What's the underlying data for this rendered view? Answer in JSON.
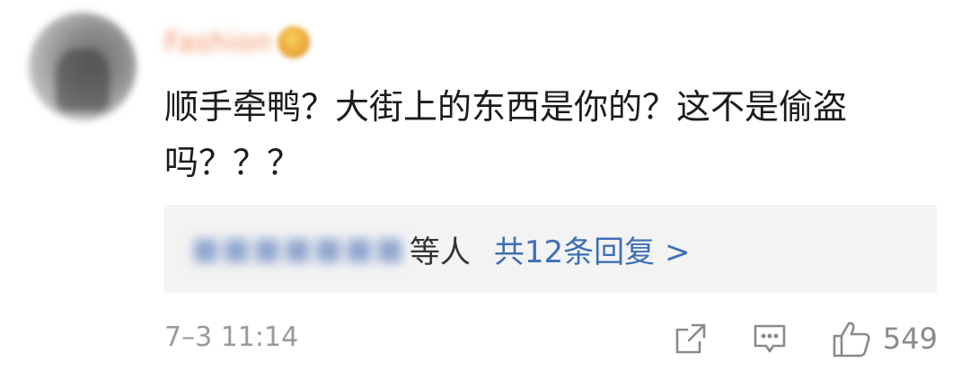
{
  "comment": {
    "username": "Fashion",
    "text": "顺手牵鸭？大街上的东西是你的？这不是偷盗吗？？？",
    "replies": {
      "names_blurred": "",
      "others_suffix": "等人",
      "link_text": "共12条回复 >"
    },
    "timestamp": "7–3 11:14",
    "actions": {
      "share_icon": "share-icon",
      "reply_icon": "comment-icon",
      "like_icon": "thumbs-up-icon",
      "like_count": "549"
    }
  },
  "colors": {
    "username": "#f08a5d",
    "link": "#3f6fb5",
    "reply_box_bg": "#f3f3f3",
    "meta_gray": "#9a9a9a"
  }
}
